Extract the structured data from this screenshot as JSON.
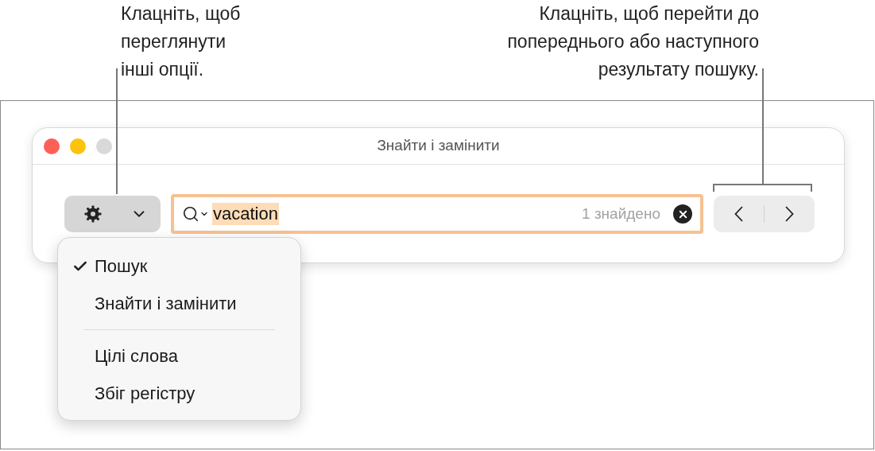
{
  "callouts": [
    {
      "kind": "left",
      "lines": [
        "Клацніть, щоб",
        "переглянути",
        "інші опції."
      ]
    },
    {
      "kind": "right",
      "lines": [
        "Клацніть, щоб перейти до",
        "попереднього або наступного",
        "результату пошуку."
      ]
    }
  ],
  "window": {
    "title": "Знайти і замінити",
    "search": {
      "value": "vacation",
      "focused": true,
      "count": "1 знайдено"
    }
  },
  "menu": {
    "sections": [
      [
        {
          "label": "Пошук",
          "checked": true
        },
        {
          "label": "Знайти і замінити",
          "checked": false
        }
      ],
      [
        {
          "label": "Цілі слова",
          "checked": false
        },
        {
          "label": "Збіг регістру",
          "checked": false
        }
      ]
    ]
  }
}
